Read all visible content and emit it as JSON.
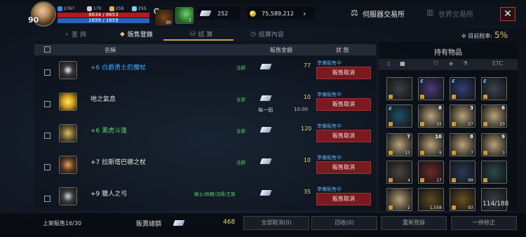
{
  "topbar": {
    "level": "90",
    "stat1": "2767",
    "stat2": "170",
    "stat3": "259",
    "stat4": "255",
    "hp_text": "8634 / 8653",
    "mp_text": "1659 / 1659",
    "bag_count": "00",
    "leaf_count": "2",
    "feather_amount": "252",
    "gold_amount": "75,589,212",
    "tab_server": "伺服器交易所",
    "tab_world": "世界交易所",
    "close_label": "✕"
  },
  "subtabs": {
    "search": "查 詢",
    "sell": "販售登錄",
    "settle": "結 算",
    "history": "結算內容",
    "tax_label": "目前稅率:",
    "tax_value": "5%"
  },
  "list": {
    "col_name": "名稱",
    "col_price": "販售金額",
    "col_status": "狀 態",
    "rows": [
      {
        "name": "+6 白爵勇士的魔杖",
        "class": "法師",
        "price": "77",
        "status": "準備販售中",
        "button": "販售取消",
        "name_color": "#3fa7ff"
      },
      {
        "name": "地之氣息",
        "class": "全部",
        "price": "10",
        "status": "準備販售中",
        "button": "販售取消",
        "name_color": "#e6e6e6",
        "per_label": "每一個",
        "per_price": "10.00"
      },
      {
        "name": "+6 黑虎斗篷",
        "class": "全部",
        "price": "120",
        "status": "準備販售中",
        "button": "販售取消",
        "name_color": "#5fd26a"
      },
      {
        "name": "+7 拉斯塔巴德之杖",
        "class": "法師",
        "price": "10",
        "status": "準備販售中",
        "button": "販售取消",
        "name_color": "#e6e6e6"
      },
      {
        "name": "+9 獵人之弓",
        "class": "騎士/妖精/法師/王族",
        "price": "35",
        "status": "準備販售中",
        "button": "販售取消",
        "name_color": "#e6e6e6"
      }
    ]
  },
  "inventory": {
    "title": "持有物品",
    "filters": [
      "▯",
      "▦",
      "⛉",
      "◈",
      "⚗",
      "ETC"
    ],
    "count": "114/188",
    "slots": [
      {
        "q": "",
        "b": "",
        "e": false,
        "lock": true,
        "color": "#3a3f46"
      },
      {
        "q": "",
        "b": "",
        "e": true,
        "lock": true,
        "color": "#4a3a7a"
      },
      {
        "q": "",
        "b": "",
        "e": true,
        "lock": true,
        "color": "#2f3f7a"
      },
      {
        "q": "",
        "b": "",
        "e": true,
        "lock": true,
        "color": "#3a4450"
      },
      {
        "q": "",
        "b": "",
        "e": true,
        "lock": true,
        "color": "#1f4f6a"
      },
      {
        "q": "8",
        "b": "15",
        "e": false,
        "lock": true,
        "color": "#b8a27a"
      },
      {
        "q": "3",
        "b": "27",
        "e": false,
        "lock": true,
        "color": "#b8a27a"
      },
      {
        "q": "6",
        "b": "23",
        "e": false,
        "lock": true,
        "color": "#b8a27a"
      },
      {
        "q": "7",
        "b": "13",
        "e": false,
        "lock": true,
        "color": "#b8a27a"
      },
      {
        "q": "10",
        "b": "9",
        "e": false,
        "lock": true,
        "color": "#b8a27a"
      },
      {
        "q": "8",
        "b": "7",
        "e": false,
        "lock": true,
        "color": "#b8a27a"
      },
      {
        "q": "9",
        "b": "3",
        "e": false,
        "lock": true,
        "color": "#b8a27a"
      },
      {
        "q": "",
        "b": "4",
        "e": false,
        "lock": true,
        "color": "#4a4440"
      },
      {
        "q": "",
        "b": "17",
        "e": false,
        "lock": true,
        "color": "#6a2a2a"
      },
      {
        "q": "",
        "b": "99",
        "e": false,
        "lock": true,
        "color": "#2a3a5a"
      },
      {
        "q": "",
        "b": "",
        "e": false,
        "lock": true,
        "color": "#2a4a4a"
      },
      {
        "q": "",
        "b": "2",
        "e": false,
        "lock": true,
        "color": "#b8a27a"
      },
      {
        "q": "",
        "b": "1,558",
        "e": false,
        "lock": false,
        "color": "#5a4a20"
      },
      {
        "q": "",
        "b": "93",
        "e": false,
        "lock": true,
        "color": "#6a5020"
      },
      {
        "q": "",
        "b": "",
        "e": false,
        "lock": false,
        "color": "#3a4048"
      }
    ]
  },
  "bottom": {
    "reg_count": "上架販售16/30",
    "total_label": "販賣總額",
    "total_value": "468",
    "btn_cancel_all": "全部取消(0)",
    "btn_collect": "回收(0)",
    "btn_reregister": "重新登錄",
    "btn_edit_all": "一併修正"
  }
}
